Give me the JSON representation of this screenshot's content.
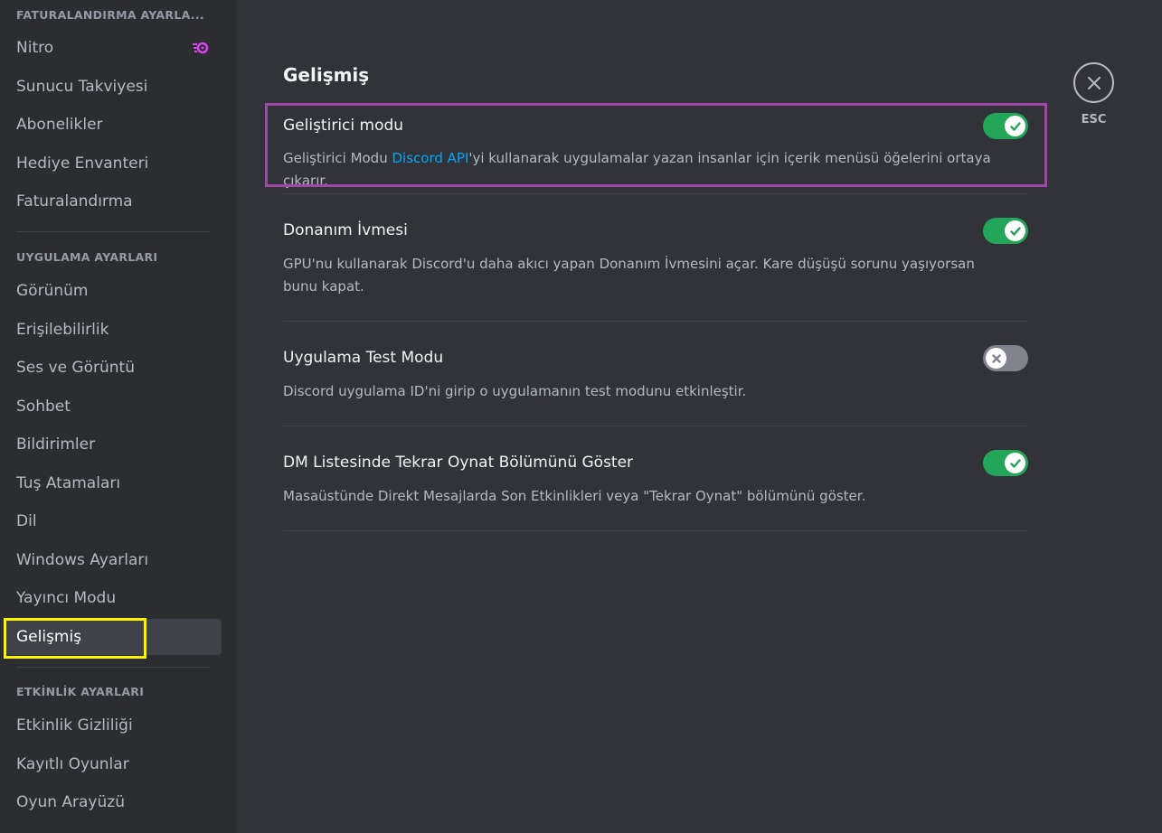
{
  "sidebar": {
    "billing_header": "FATURALANDIRMA AYARLA...",
    "billing_items": [
      {
        "label": "Nitro",
        "icon": "nitro-icon"
      },
      {
        "label": "Sunucu Takviyesi"
      },
      {
        "label": "Abonelikler"
      },
      {
        "label": "Hediye Envanteri"
      },
      {
        "label": "Faturalandırma"
      }
    ],
    "app_header": "UYGULAMA AYARLARI",
    "app_items": [
      {
        "label": "Görünüm"
      },
      {
        "label": "Erişilebilirlik"
      },
      {
        "label": "Ses ve Görüntü"
      },
      {
        "label": "Sohbet"
      },
      {
        "label": "Bildirimler"
      },
      {
        "label": "Tuş Atamaları"
      },
      {
        "label": "Dil"
      },
      {
        "label": "Windows Ayarları"
      },
      {
        "label": "Yayıncı Modu"
      },
      {
        "label": "Gelişmiş",
        "active": true
      }
    ],
    "activity_header": "ETKİNLİK AYARLARI",
    "activity_items": [
      {
        "label": "Etkinlik Gizliliği"
      },
      {
        "label": "Kayıtlı Oyunlar"
      },
      {
        "label": "Oyun Arayüzü"
      }
    ]
  },
  "main": {
    "title": "Gelişmiş",
    "settings": [
      {
        "title": "Geliştirici modu",
        "desc_before": "Geliştirici Modu ",
        "desc_link": "Discord API",
        "desc_after": "'yi kullanarak uygulamalar yazan insanlar için içerik menüsü öğelerini ortaya çıkarır.",
        "enabled": true
      },
      {
        "title": "Donanım İvmesi",
        "desc": "GPU'nu kullanarak Discord'u daha akıcı yapan Donanım İvmesini açar. Kare düşüşü sorunu yaşıyorsan bunu kapat.",
        "enabled": true
      },
      {
        "title": "Uygulama Test Modu",
        "desc": "Discord uygulama ID'ni girip o uygulamanın test modunu etkinleştir.",
        "enabled": false
      },
      {
        "title": "DM Listesinde Tekrar Oynat Bölümünü Göster",
        "desc": "Masaüstünde Direkt Mesajlarda Son Etkinlikleri veya \"Tekrar Oynat\" bölümünü göster.",
        "enabled": true
      }
    ]
  },
  "close": {
    "label": "ESC",
    "icon": "close-icon"
  },
  "colors": {
    "accent_green": "#23a55a",
    "link_blue": "#00a8fc",
    "highlight_yellow": "#fff200",
    "highlight_purple": "#a048a8"
  }
}
